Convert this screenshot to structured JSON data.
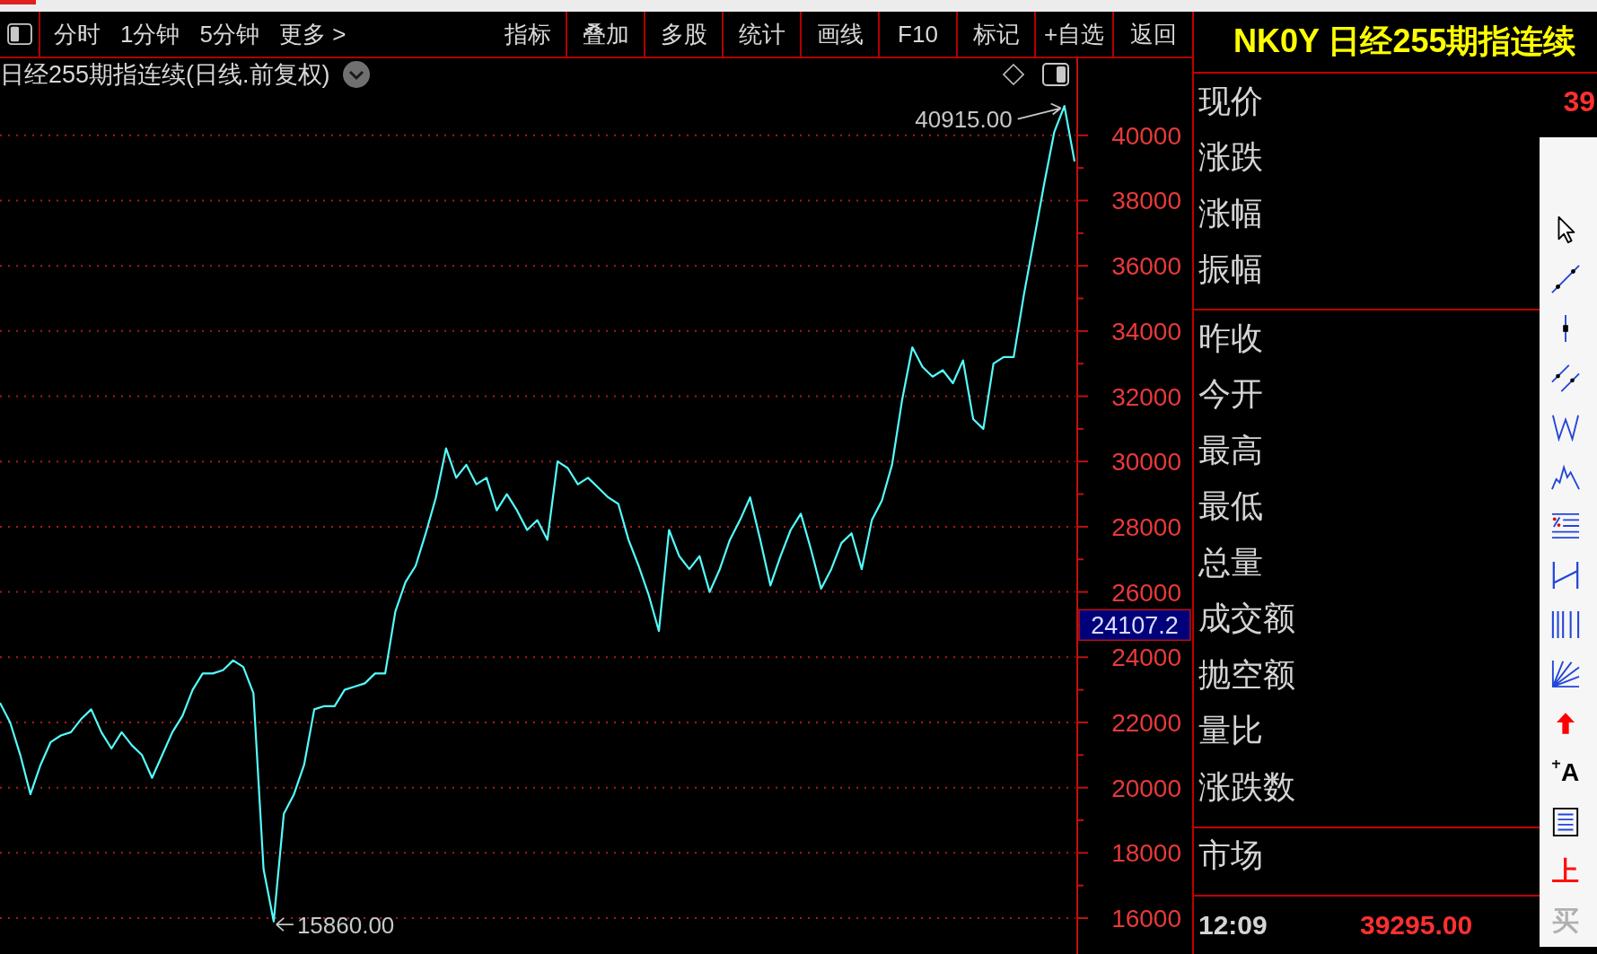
{
  "toolbar": {
    "period_tabs": [
      {
        "label": "分时",
        "selected": false
      },
      {
        "label": "1分钟",
        "selected": false
      },
      {
        "label": "5分钟",
        "selected": false
      }
    ],
    "more_menu": "更多 >",
    "buttons": [
      "指标",
      "叠加",
      "多股",
      "统计",
      "画线",
      "F10",
      "标记",
      "+自选",
      "返回"
    ]
  },
  "chart": {
    "title": "日经255期指连续(日线.前复权)",
    "price_marker": "24107.2",
    "chart_data": {
      "type": "line",
      "grid": true,
      "ylim": [
        14900,
        41370
      ],
      "yticks": [
        16000,
        18000,
        20000,
        22000,
        24000,
        26000,
        28000,
        30000,
        32000,
        34000,
        36000,
        38000,
        40000
      ],
      "series": [
        {
          "color": "#54fcfc",
          "values": [
            22600,
            22000,
            21000,
            19800,
            20700,
            21400,
            21600,
            21700,
            22100,
            22400,
            21700,
            21200,
            21700,
            21300,
            21000,
            20300,
            21000,
            21700,
            22200,
            23000,
            23500,
            23500,
            23600,
            23900,
            23700,
            22900,
            17500,
            15900,
            19200,
            19800,
            20700,
            22400,
            22500,
            22500,
            23000,
            23100,
            23200,
            23500,
            23500,
            25400,
            26300,
            26800,
            27800,
            28900,
            30400,
            29500,
            29900,
            29300,
            29500,
            28500,
            29000,
            28500,
            27900,
            28200,
            27600,
            30000,
            29800,
            29300,
            29500,
            29200,
            28900,
            28700,
            27600,
            26800,
            25900,
            24800,
            27900,
            27100,
            26700,
            27100,
            26000,
            26700,
            27600,
            28200,
            28900,
            27600,
            26200,
            27100,
            27900,
            28400,
            27300,
            26100,
            26700,
            27500,
            27800,
            26700,
            28200,
            28800,
            29900,
            31900,
            33500,
            32900,
            32600,
            32800,
            32400,
            33100,
            31300,
            31000,
            33000,
            33200,
            33200,
            35100,
            36800,
            38500,
            40100,
            40900,
            39200
          ]
        }
      ],
      "annotations": [
        "40915.00",
        "15860.00"
      ]
    }
  },
  "quote_panel": {
    "header": "NK0Y 日经255期指连续",
    "groups": [
      {
        "rows": [
          {
            "label": "现价",
            "value": "39"
          },
          {
            "label": "涨跌"
          },
          {
            "label": "涨幅"
          },
          {
            "label": "振幅"
          }
        ]
      },
      {
        "rows": [
          {
            "label": "昨收"
          },
          {
            "label": "今开"
          },
          {
            "label": "最高"
          },
          {
            "label": "最低"
          },
          {
            "label": "总量"
          },
          {
            "label": "成交额"
          },
          {
            "label": "抛空额"
          },
          {
            "label": "量比"
          },
          {
            "label": "涨跌数"
          }
        ]
      },
      {
        "rows": [
          {
            "label": "市场"
          }
        ]
      }
    ],
    "last_tick": {
      "time": "12:09",
      "price": "39295.00"
    }
  },
  "drawing_tools": [
    {
      "kind": "cursor",
      "disabled": false
    },
    {
      "kind": "segment",
      "disabled": false
    },
    {
      "kind": "vline",
      "disabled": false
    },
    {
      "kind": "parallel",
      "disabled": false
    },
    {
      "kind": "wave",
      "disabled": false
    },
    {
      "kind": "zigzag",
      "disabled": false
    },
    {
      "kind": "percent",
      "disabled": false
    },
    {
      "kind": "range",
      "disabled": false
    },
    {
      "kind": "cycle",
      "disabled": false
    },
    {
      "kind": "fan",
      "disabled": false
    },
    {
      "kind": "arrow",
      "disabled": false
    },
    {
      "kind": "text",
      "label": "A",
      "disabled": false
    },
    {
      "kind": "note",
      "disabled": false
    },
    {
      "kind": "mark",
      "label": "上",
      "disabled": false
    },
    {
      "kind": "mark",
      "label": "买",
      "disabled": true
    }
  ]
}
